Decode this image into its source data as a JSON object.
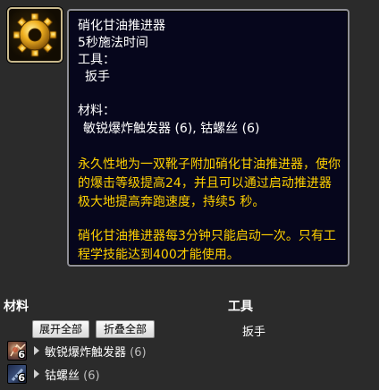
{
  "tooltip": {
    "icon": "gear-icon",
    "title": "硝化甘油推进器",
    "cast_time": "5秒施法时间",
    "tools_label": "工具：",
    "tool": "扳手",
    "materials_label": "材料：",
    "materials_text": "敏锐爆炸触发器 (6), 钴螺丝 (6)",
    "description": "永久性地为一双靴子附加硝化甘油推进器，使你的爆击等级提高24，并且可以通过启动推进器极大地提高奔跑速度，持续5 秒。",
    "note": "硝化甘油推进器每3分钟只能启动一次。只有工程学技能达到400才能使用。"
  },
  "materials_section": {
    "title": "材料",
    "expand_all": "展开全部",
    "collapse_all": "折叠全部",
    "items": [
      {
        "name": "敏锐爆炸触发器",
        "qty": "(6)",
        "count": "6",
        "icon": "trigger-icon"
      },
      {
        "name": "钴螺丝",
        "qty": "(6)",
        "count": "6",
        "icon": "screw-icon"
      }
    ]
  },
  "tools_section": {
    "title": "工具",
    "items": [
      "扳手"
    ]
  },
  "colors": {
    "tooltip_bg": "#06061c",
    "gold_text": "#ffd100",
    "page_bg": "#2b2b2b"
  }
}
